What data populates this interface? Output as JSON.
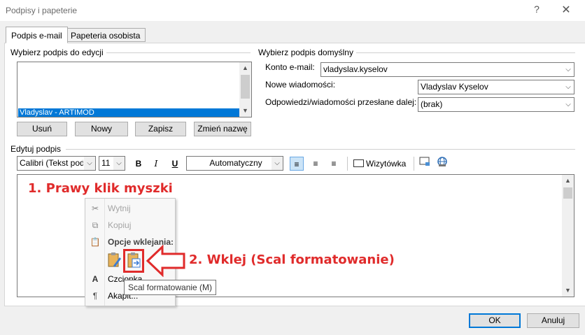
{
  "window": {
    "title": "Podpisy i papeterie",
    "help_label": "?",
    "close_label": "✕"
  },
  "tabs": [
    {
      "label": "Podpis e-mail",
      "active": true
    },
    {
      "label": "Papeteria osobista",
      "active": false
    }
  ],
  "edit_section": {
    "label": "Wybierz podpis do edycji",
    "signatures": [
      "Vladyslav - ARTIMOD"
    ],
    "selected_index": 0,
    "buttons": {
      "delete": "Usuń",
      "new": "Nowy",
      "save": "Zapisz",
      "rename": "Zmień nazwę"
    }
  },
  "default_section": {
    "label": "Wybierz podpis domyślny",
    "account_label": "Konto e-mail:",
    "account_value": "vladyslav.kyselov",
    "new_messages_label": "Nowe wiadomości:",
    "new_messages_value": "Vladyslav Kyselov",
    "replies_label": "Odpowiedzi/wiadomości przesłane dalej:",
    "replies_value": "(brak)"
  },
  "editor": {
    "label": "Edytuj podpis",
    "font_name": "Calibri (Tekst pods",
    "font_size": "11",
    "color_value": "Automatyczny",
    "business_card_label": "Wizytówka"
  },
  "annotations": {
    "step1": "1. Prawy klik myszki",
    "step2": "2. Wklej (Scal formatowanie)",
    "color": "#e02b2b"
  },
  "context_menu": {
    "cut": "Wytnij",
    "copy": "Kopiuj",
    "paste_options": "Opcje wklejania:",
    "font": "Czcionka...",
    "paragraph": "Akapit..."
  },
  "tooltip": "Scal formatowanie (M)",
  "footer": {
    "ok": "OK",
    "cancel": "Anuluj"
  },
  "colors": {
    "selection": "#0078d7",
    "accent_button_border": "#0078d7",
    "annotation_red": "#e02b2b"
  }
}
